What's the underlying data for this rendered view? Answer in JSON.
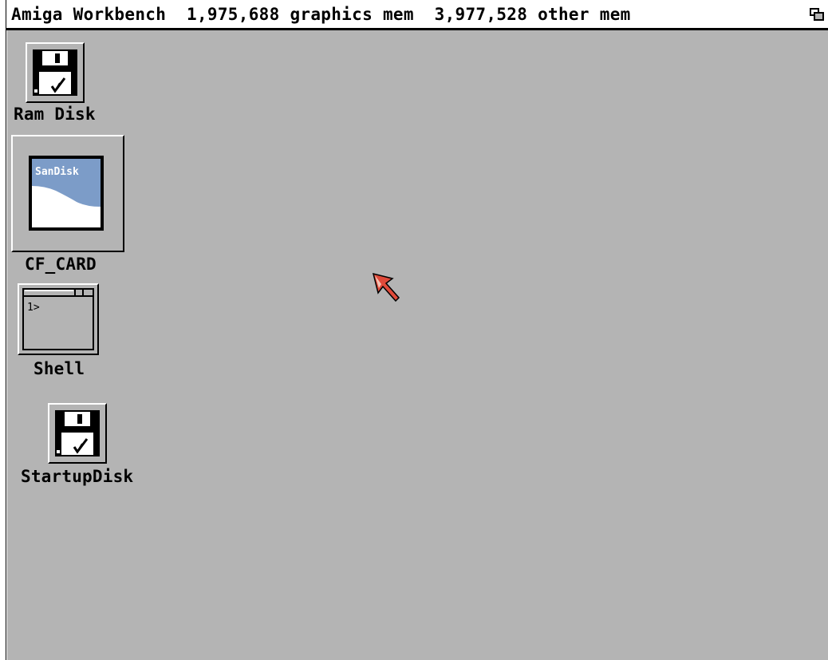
{
  "screen": {
    "title": "Amiga Workbench  1,975,688 graphics mem  3,977,528 other mem",
    "depth_gadget_icon": "depth-arrange-icon"
  },
  "desktop": {
    "background_color": "#b4b4b4",
    "icons": [
      {
        "label": "Ram Disk",
        "icon": "floppy-disk-icon"
      },
      {
        "label": "CF_CARD",
        "icon": "sandisk-card-icon",
        "card_brand": "SanDisk"
      },
      {
        "label": "Shell",
        "icon": "shell-window-icon",
        "prompt": "1>"
      },
      {
        "label": "StartupDisk",
        "icon": "floppy-disk-icon"
      }
    ]
  },
  "colors": {
    "desktop": "#b4b4b4",
    "pointer": "#e04a3a",
    "sandisk_blue": "#7c9cc8"
  }
}
